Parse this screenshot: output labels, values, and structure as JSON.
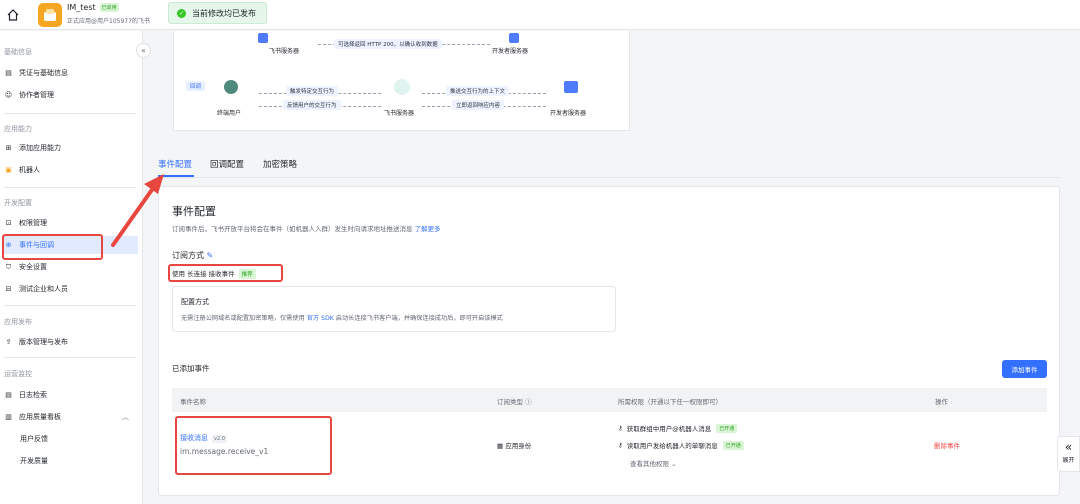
{
  "header": {
    "app_name": "IM_test",
    "app_status": "已启用",
    "app_subtitle": "正式应用@用户105977的飞书",
    "toast": "当前修改均已发布"
  },
  "sidebar": {
    "collapse_icon": "«",
    "sections": [
      {
        "title": "基础信息",
        "items": [
          {
            "label": "凭证与基础信息",
            "icon": "card-icon"
          },
          {
            "label": "协作者管理",
            "icon": "user-icon"
          }
        ]
      },
      {
        "title": "应用能力",
        "items": [
          {
            "label": "添加应用能力",
            "icon": "grid-icon"
          },
          {
            "label": "机器人",
            "icon": "robot-icon"
          }
        ]
      },
      {
        "title": "开发配置",
        "items": [
          {
            "label": "权限管理",
            "icon": "lock-icon"
          },
          {
            "label": "事件与回调",
            "icon": "event-icon",
            "active": true
          },
          {
            "label": "安全设置",
            "icon": "shield-icon"
          },
          {
            "label": "测试企业和人员",
            "icon": "test-icon"
          }
        ]
      },
      {
        "title": "应用发布",
        "items": [
          {
            "label": "版本管理与发布",
            "icon": "upload-icon"
          }
        ]
      },
      {
        "title": "运营监控",
        "items": [
          {
            "label": "日志检索",
            "icon": "log-icon"
          },
          {
            "label": "应用质量看板",
            "icon": "chart-icon"
          },
          {
            "label": "用户反馈",
            "icon": ""
          },
          {
            "label": "开发质量",
            "icon": ""
          }
        ]
      }
    ]
  },
  "diagram": {
    "top_server_left": "飞书服务器",
    "top_hint": "可选择返回 HTTP 200，以确认收到数据",
    "top_server_right": "开发者服务器",
    "callback_tag": "回调",
    "end_user": "终端用户",
    "trigger": "触发特定交互行为",
    "feedback": "反馈用户的交互行为",
    "feishu_server": "飞书服务器",
    "push_context": "推送交互行为的上下文",
    "return_content": "立即返回响应内容",
    "dev_server": "开发者服务器"
  },
  "tabs": [
    "事件配置",
    "回调配置",
    "加密策略"
  ],
  "event_config": {
    "title": "事件配置",
    "desc": "订阅事件后，飞书开放平台将会在事件（如机器人入群）发生时向请求地址推送消息",
    "learn_more": "了解更多",
    "subscribe_label": "订阅方式",
    "mode_prefix": "使用",
    "mode_value": "长连接",
    "mode_suffix": "接收事件",
    "recommend": "推荐",
    "config_title": "配置方式",
    "config_desc_a": "无需注册公网域名或配置加密策略，仅需使用",
    "config_link": "官方 SDK",
    "config_desc_b": "启动长连接飞书客户端，并确保连接成功后，即可开启该模式"
  },
  "events": {
    "title": "已添加事件",
    "add_button": "添加事件",
    "columns": [
      "事件名称",
      "订阅类型 ⓘ",
      "所需权限（开通以下任一权限即可）",
      "操作"
    ],
    "rows": [
      {
        "name": "接收消息",
        "version": "v2.0",
        "code": "im.message.receive_v1",
        "type": "应用身份",
        "permissions": [
          {
            "label": "获取群组中用户@机器人消息",
            "status": "已开通"
          },
          {
            "label": "读取用户发给机器人的单聊消息",
            "status": "已开通"
          }
        ],
        "more": "查看其他权限",
        "action": "删除事件"
      }
    ]
  },
  "float_button": {
    "icon": "«",
    "label": "展开"
  }
}
